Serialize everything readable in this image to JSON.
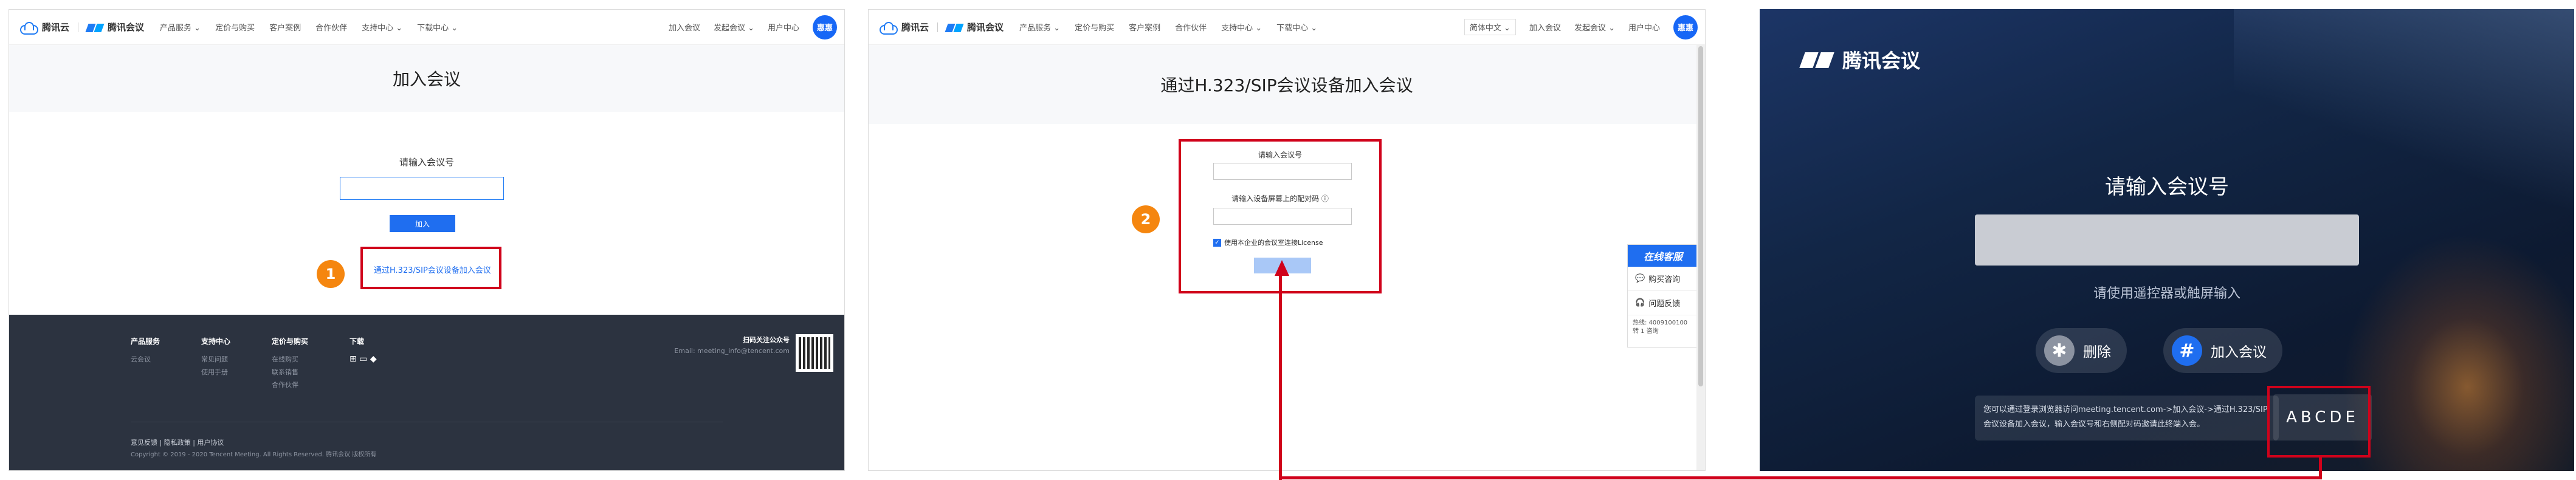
{
  "panel1": {
    "nav": {
      "brand_cloud": "腾讯云",
      "brand_meeting": "腾讯会议",
      "menu": [
        "产品服务 ⌄",
        "定价与购买",
        "客户案例",
        "合作伙伴",
        "支持中心 ⌄",
        "下载中心 ⌄"
      ],
      "right": [
        "加入会议",
        "发起会议 ⌄",
        "用户中心"
      ],
      "avatar": "惠惠"
    },
    "hero_title": "加入会议",
    "label": "请输入会议号",
    "join_button": "加入",
    "sip_link": "通过H.323/SIP会议设备加入会议",
    "step": "1",
    "footer": {
      "cols": [
        {
          "title": "产品服务",
          "items": [
            "云会议"
          ]
        },
        {
          "title": "支持中心",
          "items": [
            "常见问题",
            "使用手册"
          ]
        },
        {
          "title": "定价与购买",
          "items": [
            "在线购买",
            "联系销售",
            "合作伙伴"
          ]
        },
        {
          "title": "下载",
          "items": [
            "⊞ ▭ ◆ "
          ]
        }
      ],
      "wechat": "扫码关注公众号",
      "email": "Email: meeting_info@tencent.com",
      "links": "意见反馈 | 隐私政策 | 用户协议",
      "copyright": "Copyright © 2019 - 2020 Tencent Meeting. All Rights Reserved. 腾讯会议 版权所有"
    }
  },
  "panel2": {
    "nav": {
      "brand_cloud": "腾讯云",
      "brand_meeting": "腾讯会议",
      "menu": [
        "产品服务 ⌄",
        "定价与购买",
        "客户案例",
        "合作伙伴",
        "支持中心 ⌄",
        "下载中心 ⌄"
      ],
      "right": [
        "简体中文 ⌄",
        "加入会议",
        "发起会议 ⌄",
        "用户中心"
      ],
      "avatar": "惠惠"
    },
    "hero_title": "通过H.323/SIP会议设备加入会议",
    "label_meeting": "请输入会议号",
    "label_pair": "请输入设备屏幕上的配对码 ⓘ",
    "checkbox_text": "使用本企业的会议室连接License",
    "step": "2",
    "service": {
      "title": "在线客服",
      "items": [
        "购买咨询",
        "问题反馈"
      ],
      "tel": "热线: 4009100100 转 1 咨询"
    }
  },
  "panel3": {
    "brand": "腾讯会议",
    "title": "请输入会议号",
    "hint": "请使用遥控器或触屏输入",
    "delete_label": "删除",
    "join_label": "加入会议",
    "info": "您可以通过登录浏览器访问meeting.tencent.com->加入会议->通过H.323/SIP会议设备加入会议，输入会议号和右侧配对码邀请此终端入会。",
    "pair_code": "ABCDE"
  },
  "colors": {
    "accent": "#1f6ef0",
    "highlight": "#d0021b",
    "step": "#f5860f"
  }
}
